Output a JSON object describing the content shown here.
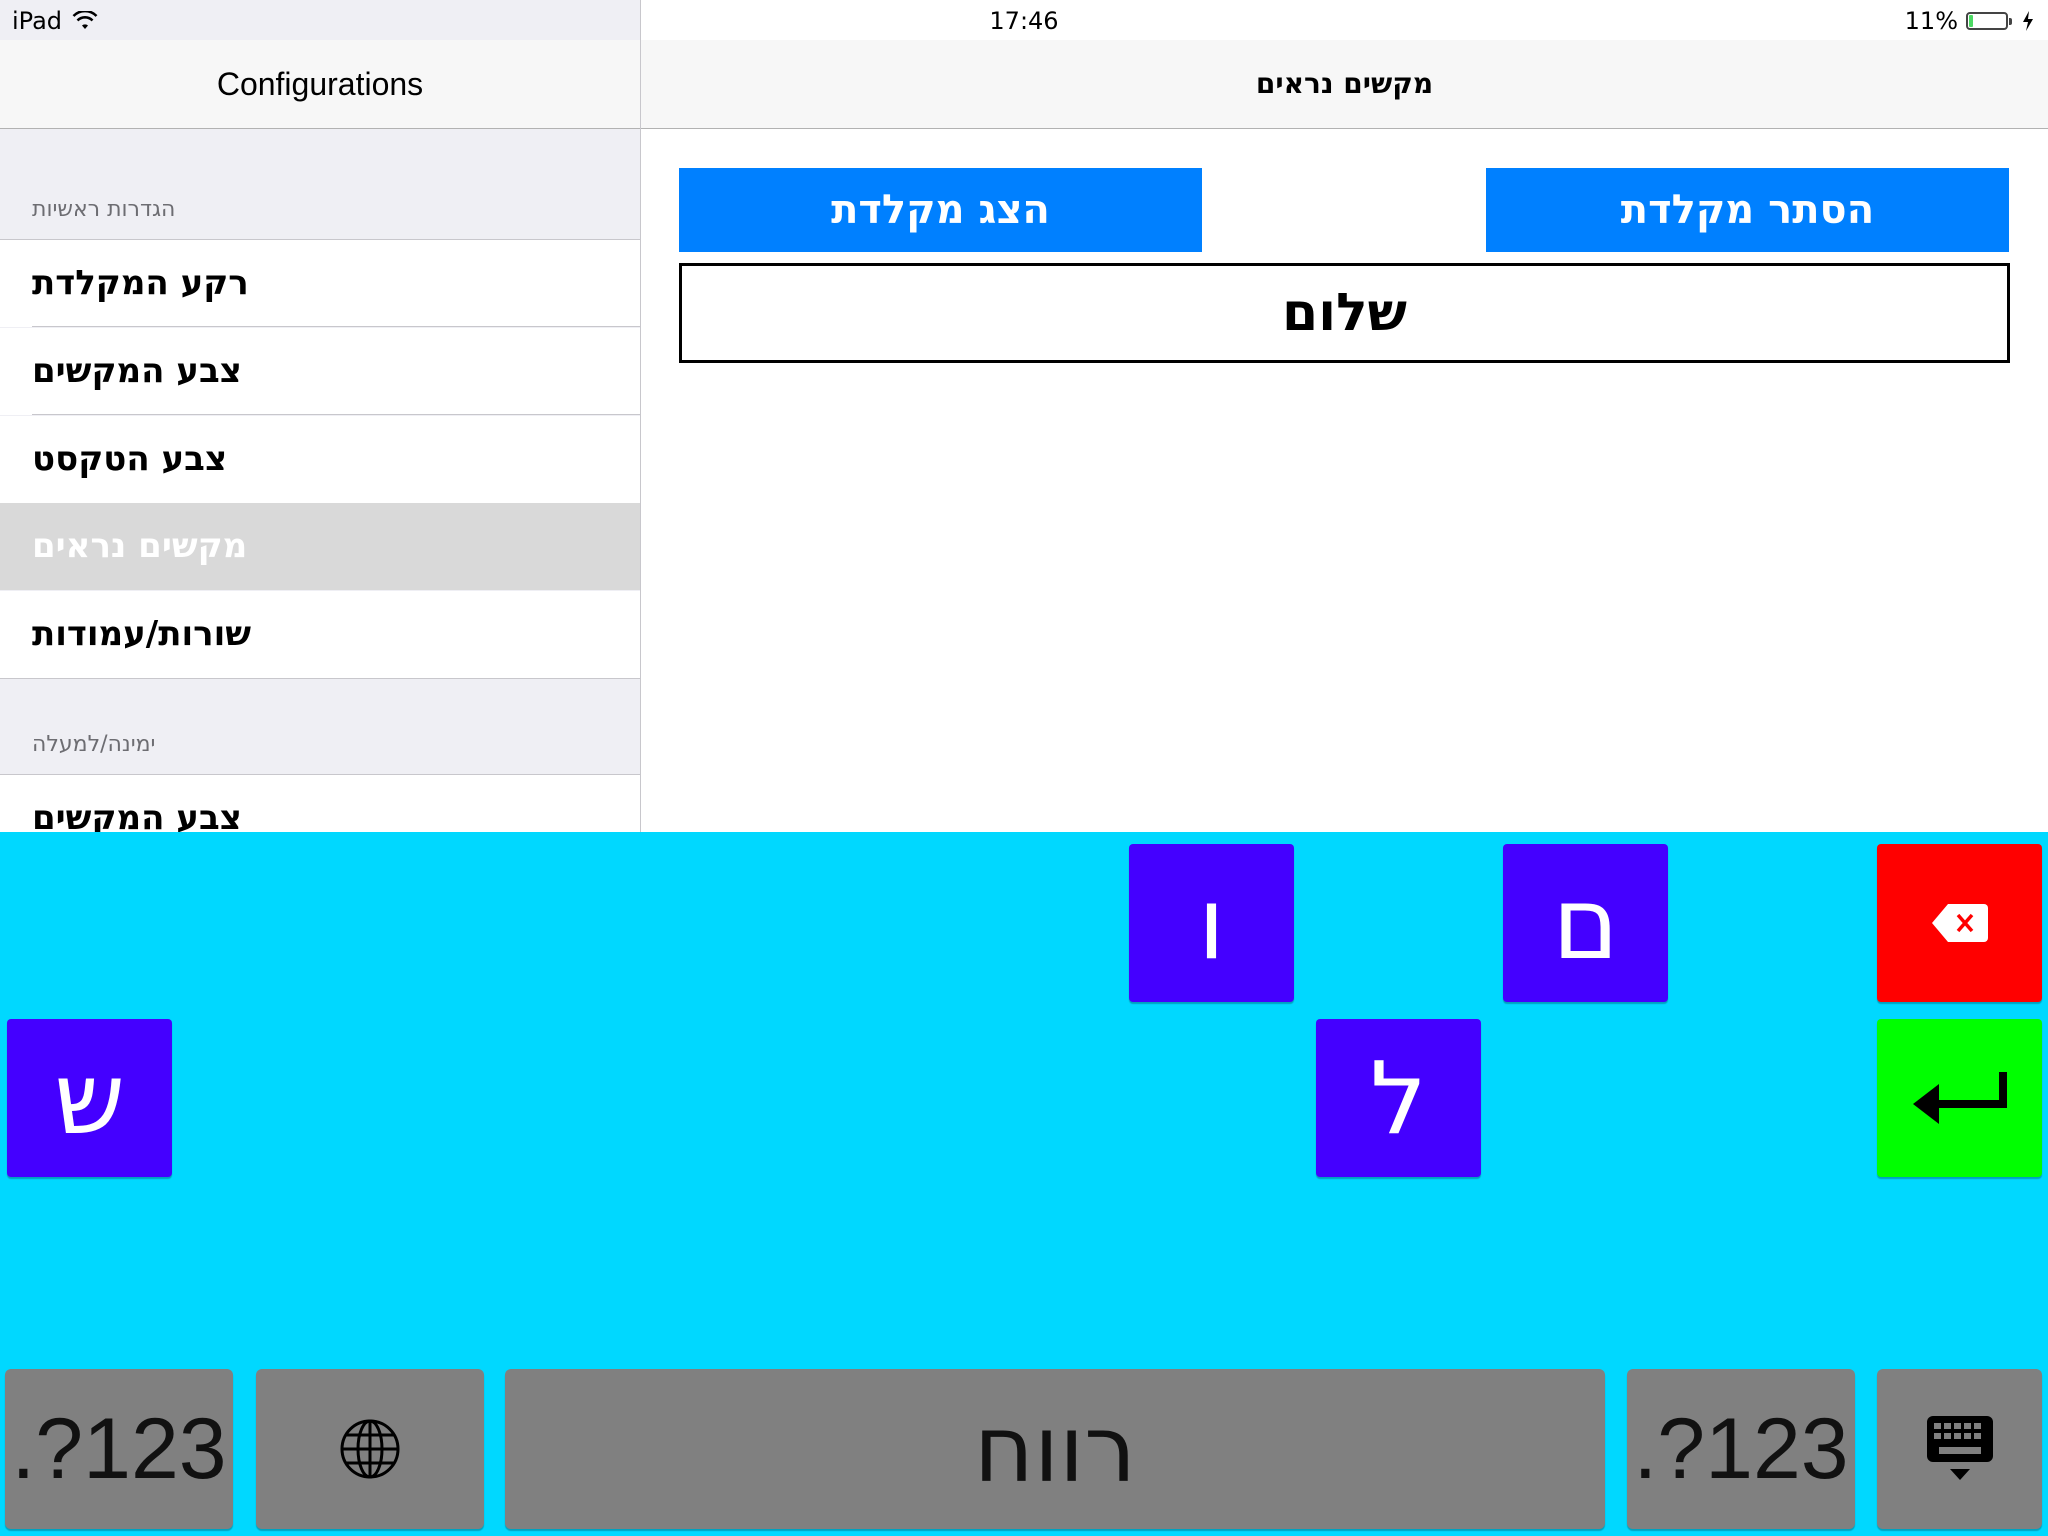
{
  "status": {
    "device": "iPad",
    "time": "17:46",
    "battery": "11%",
    "battery_level": 0.11
  },
  "master": {
    "title": "Configurations",
    "sections": [
      {
        "header": "הגדרות ראשיות",
        "items": [
          "רקע המקלדת",
          "צבע המקשים",
          "צבע הטקסט",
          "מקשים נראים",
          "שורות/עמודות"
        ]
      },
      {
        "header": "ימינה/למעלה",
        "items": [
          "צבע המקשים"
        ]
      }
    ],
    "selected": "מקשים נראים"
  },
  "detail": {
    "title": "מקשים נראים",
    "show_keyboard": "הצג מקלדת",
    "hide_keyboard": "הסתר מקלדת",
    "text_value": "שלום"
  },
  "keyboard": {
    "letters": {
      "vav": "ו",
      "mem": "ם",
      "shin": "ש",
      "lamed": "ל"
    },
    "bottom": {
      "numbers_left": ".?123",
      "space": "רווח",
      "numbers_right": ".?123"
    },
    "colors": {
      "background": "#00d8ff",
      "letter_key": "#4400ff",
      "delete_key": "#ff0000",
      "return_key": "#00ff00",
      "system_key": "#808080"
    },
    "icons": {
      "delete": "backspace-icon",
      "return": "return-arrow-icon",
      "globe": "globe-icon",
      "dismiss": "keyboard-dismiss-icon"
    }
  }
}
